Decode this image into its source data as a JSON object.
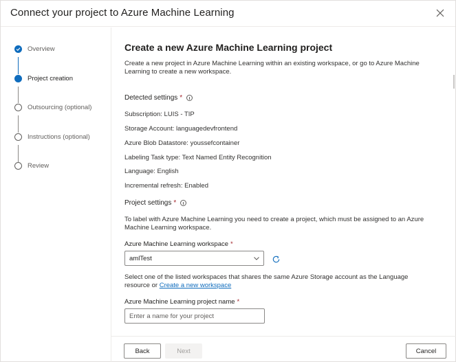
{
  "dialog": {
    "title": "Connect your project to Azure Machine Learning"
  },
  "stepper": {
    "steps": [
      {
        "label": "Overview",
        "state": "done"
      },
      {
        "label": "Project creation",
        "state": "current"
      },
      {
        "label": "Outsourcing (optional)",
        "state": "pending"
      },
      {
        "label": "Instructions (optional)",
        "state": "pending"
      },
      {
        "label": "Review",
        "state": "pending"
      }
    ]
  },
  "main": {
    "title": "Create a new Azure Machine Learning project",
    "intro": "Create a new project in Azure Machine Learning within an existing workspace, or go to Azure Machine Learning to create a new workspace.",
    "detected": {
      "label": "Detected settings",
      "required_mark": "*",
      "subscription": "Subscription:  LUIS - TIP",
      "storage": "Storage Account:  languagedevfrontend",
      "blob": "Azure Blob Datastore:  youssefcontainer",
      "task": "Labeling Task type:  Text Named Entity Recognition",
      "language": "Language:  English",
      "refresh": "Incremental refresh:  Enabled"
    },
    "project": {
      "label": "Project settings",
      "required_mark": "*",
      "description": "To label with Azure Machine Learning you need to create a project, which must be assigned to an Azure Machine Learning workspace.",
      "workspace_label": "Azure Machine Learning workspace",
      "workspace_value": "amlTest",
      "workspace_help": "Select one of the listed workspaces that shares the same Azure Storage account as the Language resource or",
      "workspace_link": "Create a new workspace",
      "name_label": "Azure Machine Learning project name",
      "name_placeholder": "Enter a name for your project"
    }
  },
  "footer": {
    "back": "Back",
    "next": "Next",
    "cancel": "Cancel"
  },
  "colors": {
    "accent": "#0f6cbd",
    "required": "#a4262c"
  }
}
